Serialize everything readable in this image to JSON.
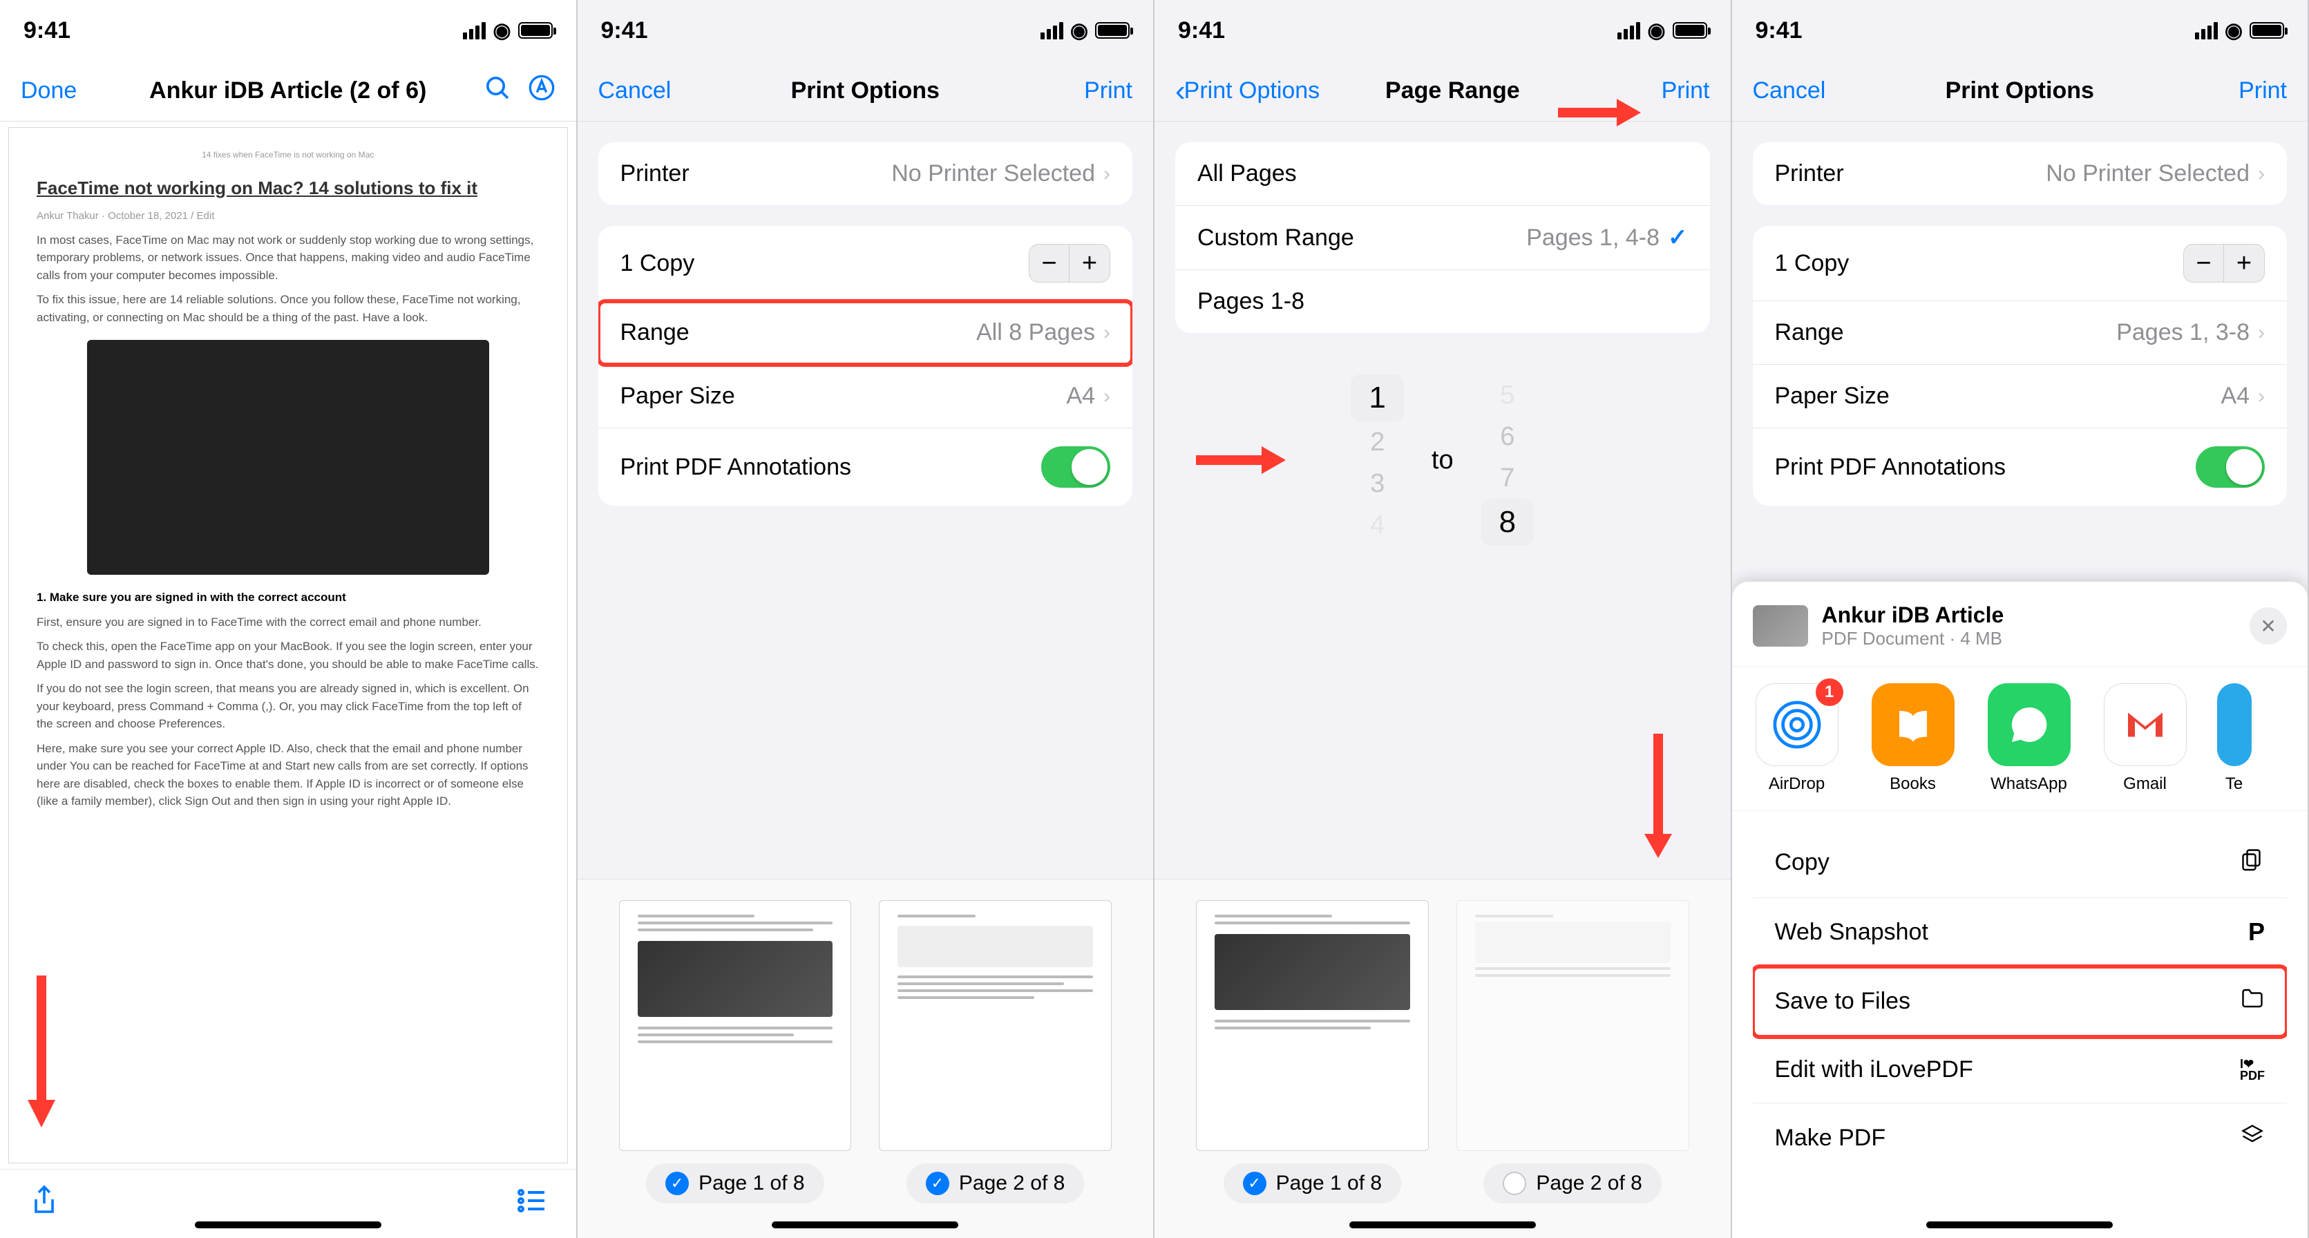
{
  "status": {
    "time": "9:41"
  },
  "screen1": {
    "done": "Done",
    "title": "Ankur iDB Article (2 of 6)",
    "doc_title": "FaceTime not working on Mac? 14 solutions to fix it",
    "byline": "Ankur Thakur · October 18, 2021 / Edit",
    "p1": "In most cases, FaceTime on Mac may not work or suddenly stop working due to wrong settings, temporary problems, or network issues. Once that happens, making video and audio FaceTime calls from your computer becomes impossible.",
    "p2": "To fix this issue, here are 14 reliable solutions. Once you follow these, FaceTime not working, activating, or connecting on Mac should be a thing of the past. Have a look.",
    "h1": "1. Make sure you are signed in with the correct account",
    "p3": "First, ensure you are signed in to FaceTime with the correct email and phone number.",
    "p4": "To check this, open the FaceTime app on your MacBook. If you see the login screen, enter your Apple ID and password to sign in. Once that's done, you should be able to make FaceTime calls.",
    "p5": "If you do not see the login screen, that means you are already signed in, which is excellent. On your keyboard, press Command + Comma (,). Or, you may click FaceTime from the top left of the screen and choose Preferences.",
    "p6": "Here, make sure you see your correct Apple ID. Also, check that the email and phone number under You can be reached for FaceTime at and Start new calls from are set correctly. If options here are disabled, check the boxes to enable them. If Apple ID is incorrect or of someone else (like a family member), click Sign Out and then sign in using your right Apple ID."
  },
  "screen2": {
    "cancel": "Cancel",
    "title": "Print Options",
    "print": "Print",
    "printer": "Printer",
    "printer_val": "No Printer Selected",
    "copies": "1 Copy",
    "range": "Range",
    "range_val": "All 8 Pages",
    "paper": "Paper Size",
    "paper_val": "A4",
    "annot": "Print PDF Annotations",
    "page1": "Page 1 of 8",
    "page2": "Page 2 of 8"
  },
  "screen3": {
    "back": "Print Options",
    "title": "Page Range",
    "print": "Print",
    "all": "All Pages",
    "custom": "Custom Range",
    "custom_val": "Pages 1, 4-8",
    "pages": "Pages 1-8",
    "from": "1",
    "to_label": "to",
    "to": "8",
    "page1": "Page 1 of 8",
    "page2": "Page 2 of 8"
  },
  "screen4": {
    "cancel": "Cancel",
    "title": "Print Options",
    "print": "Print",
    "printer": "Printer",
    "printer_val": "No Printer Selected",
    "copies": "1 Copy",
    "range": "Range",
    "range_val": "Pages 1, 3-8",
    "paper": "Paper Size",
    "paper_val": "A4",
    "annot": "Print PDF Annotations",
    "file_title": "Ankur iDB Article",
    "file_sub": "PDF Document · 4 MB",
    "apps": {
      "airdrop": "AirDrop",
      "books": "Books",
      "whatsapp": "WhatsApp",
      "gmail": "Gmail",
      "telegram": "Te",
      "badge": "1"
    },
    "actions": {
      "copy": "Copy",
      "snapshot": "Web Snapshot",
      "save": "Save to Files",
      "ilove": "Edit with iLovePDF",
      "makepdf": "Make PDF"
    }
  }
}
